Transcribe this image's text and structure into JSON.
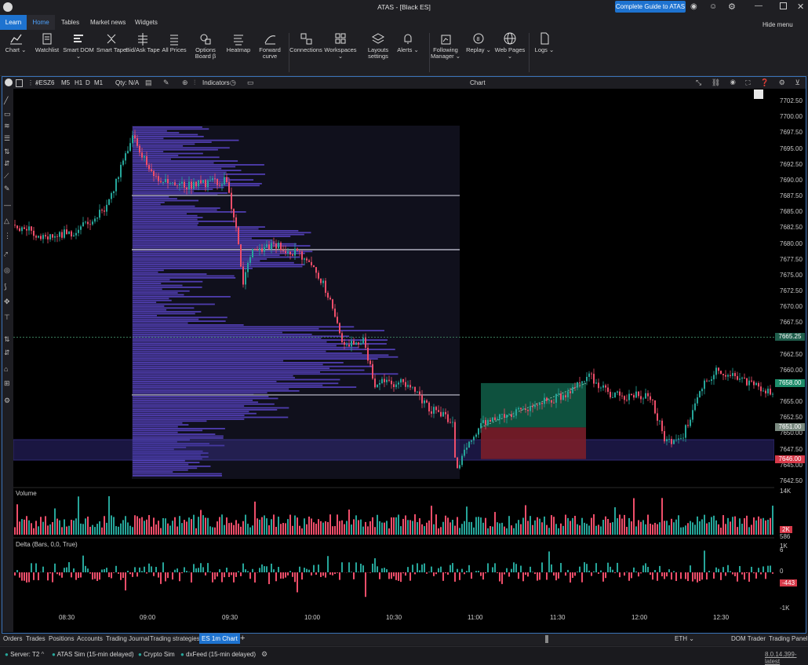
{
  "window": {
    "title": "ATAS - [Black ES]",
    "guide_button": "Complete Guide to ATAS"
  },
  "menu": {
    "learn": "Learn",
    "home": "Home",
    "tables": "Tables",
    "market_news": "Market news",
    "widgets": "Widgets",
    "hide_menu": "Hide menu"
  },
  "ribbon": [
    {
      "label": "Chart",
      "drop": true,
      "icon": "chart-icon"
    },
    {
      "label": "Watchlist",
      "drop": false,
      "icon": "watchlist-icon"
    },
    {
      "label": "Smart DOM",
      "drop": true,
      "icon": "smart-dom-icon"
    },
    {
      "label": "Smart Tape",
      "drop": false,
      "icon": "smart-tape-icon"
    },
    {
      "label": "Bid/Ask Tape",
      "drop": false,
      "icon": "bid-ask-tape-icon"
    },
    {
      "label": "All Prices",
      "drop": false,
      "icon": "all-prices-icon"
    },
    {
      "label": "Options Board β",
      "drop": false,
      "icon": "options-board-icon"
    },
    {
      "label": "Heatmap",
      "drop": false,
      "icon": "heatmap-icon"
    },
    {
      "label": "Forward curve",
      "drop": false,
      "icon": "forward-curve-icon"
    },
    {
      "label": "Connections",
      "drop": false,
      "icon": "connections-icon"
    },
    {
      "label": "Workspaces",
      "drop": true,
      "icon": "workspaces-icon"
    },
    {
      "label": "Layouts settings",
      "drop": false,
      "icon": "layouts-icon"
    },
    {
      "label": "Alerts",
      "drop": true,
      "icon": "bell-icon"
    },
    {
      "label": "Following Manager",
      "drop": true,
      "icon": "following-manager-icon"
    },
    {
      "label": "Replay",
      "drop": true,
      "icon": "replay-icon"
    },
    {
      "label": "Web Pages",
      "drop": true,
      "icon": "globe-icon"
    },
    {
      "label": "Logs",
      "drop": true,
      "icon": "logs-icon"
    }
  ],
  "chart_toolbar": {
    "symbol": "#ESZ6",
    "tf_m5": "M5",
    "tf_h1": "H1",
    "tf_d": "D",
    "tf_m1": "M1",
    "qty": "Qty: N/A",
    "indicators": "Indicators",
    "title": "Chart"
  },
  "chart": {
    "price_labels": [
      "7702.50",
      "7700.00",
      "7697.50",
      "7695.00",
      "7692.50",
      "7690.00",
      "7687.50",
      "7685.00",
      "7682.50",
      "7680.00",
      "7677.50",
      "7675.00",
      "7672.50",
      "7670.00",
      "7667.50",
      "7662.50",
      "7660.00",
      "7655.00",
      "7652.50",
      "7650.00",
      "7647.50",
      "7645.00",
      "7642.50"
    ],
    "badges": {
      "current": "7665.25",
      "tp": "7658.00",
      "entry": "7651.00",
      "sl": "7646.00"
    },
    "volume_title": "Volume",
    "volume_max": "14K",
    "volume_cur": "2K",
    "volume_small": "586",
    "delta_title": "Delta (Bars, 0,0, True)",
    "delta_max": "1K",
    "delta_zero": "0",
    "delta_cur": "-443",
    "delta_min": "-1K",
    "delta_six": "6",
    "time_labels": [
      "08:30",
      "09:00",
      "09:30",
      "10:00",
      "10:30",
      "11:00",
      "11:30",
      "12:00",
      "12:30"
    ],
    "eth": "ETH",
    "colors": {
      "up": "#26a69a",
      "down": "#ef4e6a",
      "profile": "#5b45c9",
      "badge_green": "#1e8c6a",
      "badge_red": "#d73a4a"
    }
  },
  "bottom_tabs": [
    "Orders",
    "Trades",
    "Positions",
    "Accounts",
    "Trading Journal",
    "Trading strategies",
    "ES 1m Chart"
  ],
  "bottom_right": {
    "dom_trader": "DOM Trader",
    "trading_panel": "Trading Panel"
  },
  "status": {
    "server": "Server: T2",
    "atas_sim": "ATAS Sim (15-min delayed)",
    "crypto_sim": "Crypto Sim",
    "dxfeed": "dxFeed (15-min delayed)",
    "version": "8.0.14.399-latest"
  }
}
